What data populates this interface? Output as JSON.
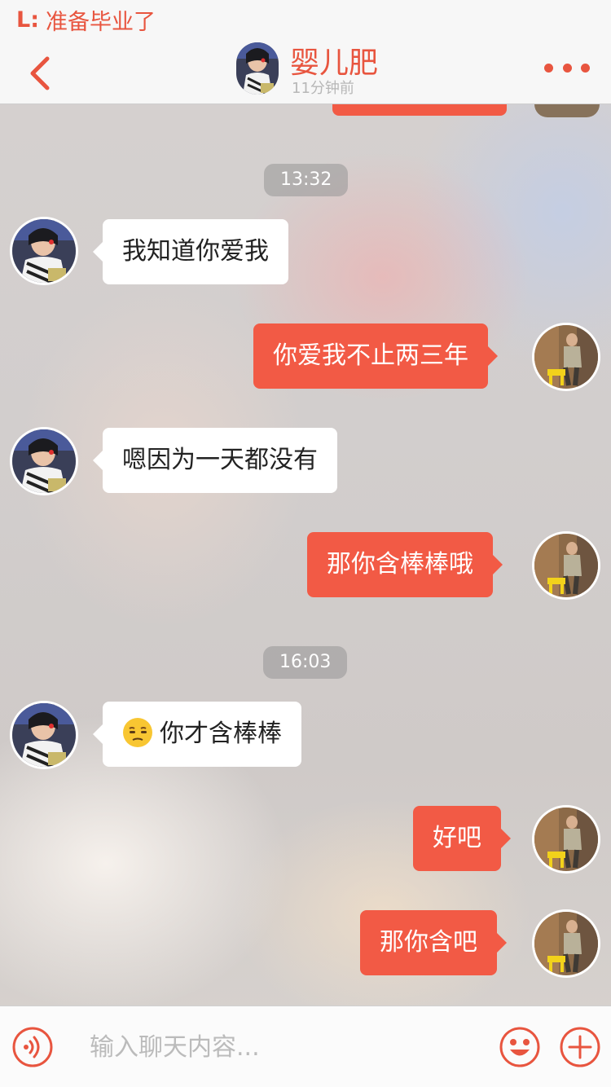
{
  "status": {
    "prefix": "L:",
    "text": "准备毕业了"
  },
  "nav": {
    "title": "婴儿肥",
    "subtitle": "11分钟前"
  },
  "times": [
    "13:32",
    "16:03"
  ],
  "messages": [
    {
      "side": "in",
      "text": "我知道你爱我"
    },
    {
      "side": "out",
      "text": "你爱我不止两三年"
    },
    {
      "side": "in",
      "text": "嗯因为一天都没有"
    },
    {
      "side": "out",
      "text": "那你含棒棒哦"
    },
    {
      "side": "in",
      "text": "你才含棒棒",
      "emoji": "unamused-face"
    },
    {
      "side": "out",
      "text": "好吧"
    },
    {
      "side": "out",
      "text": "那你含吧"
    }
  ],
  "input": {
    "placeholder": "输入聊天内容..."
  },
  "colors": {
    "accent": "#f25a45",
    "nav_accent": "#e8553f"
  }
}
